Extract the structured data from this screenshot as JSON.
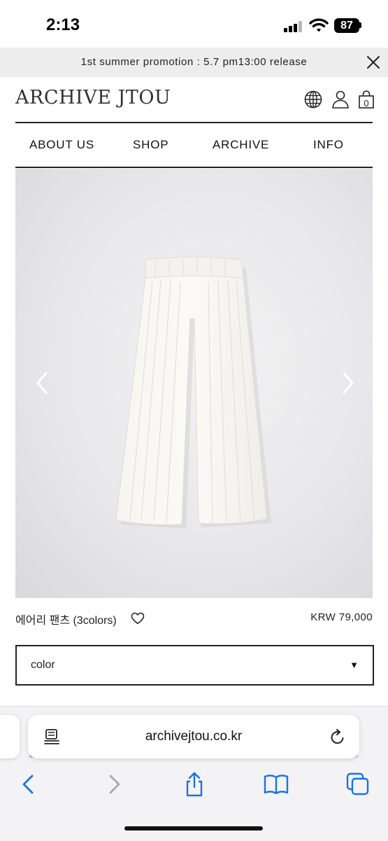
{
  "status": {
    "time": "2:13",
    "battery": "87"
  },
  "promo": {
    "text": "1st summer promotion : 5.7 pm13:00 release"
  },
  "header": {
    "logo": "ARCHIVE JTOU",
    "cart_count": "0"
  },
  "nav": {
    "items": [
      "ABOUT US",
      "SHOP",
      "ARCHIVE",
      "INFO"
    ]
  },
  "product": {
    "name": "에어리 팬츠 (3colors)",
    "price": "KRW 79,000",
    "option_label": "color"
  },
  "browser": {
    "url": "archivejtou.co.kr"
  },
  "colors": {
    "accent": "#1a73e8",
    "text": "#222222",
    "promo_bg": "#ededed"
  }
}
